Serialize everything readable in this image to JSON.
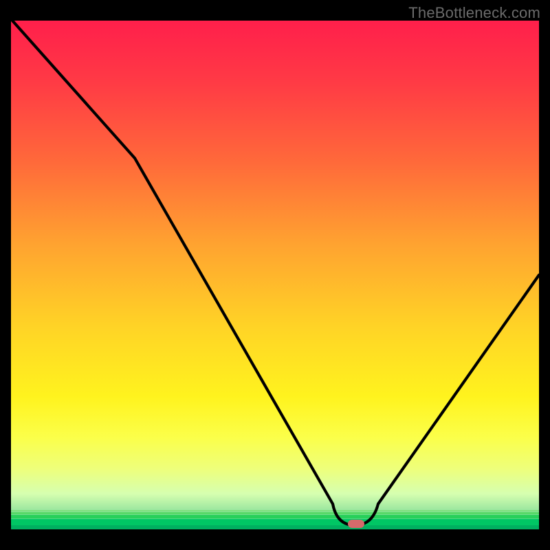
{
  "watermark": "TheBottleneck.com",
  "gradient_css": "background: linear-gradient(to bottom, #ff1f4b 0%, #ff3a45 12%, #ff6a3a 28%, #ffa330 44%, #ffd326 60%, #fff31e 74%, #fbff4a 82%, #eeff7a 88%, #d6ffb0 93%, #9fe8a0 96%, #00c764 100%);",
  "colors": {
    "worst": "#ff1f4b",
    "mid": "#ffd326",
    "best": "#00c764",
    "curve": "#000000",
    "marker": "#d66a6b",
    "frame": "#000000",
    "watermark": "#6b6b6b"
  },
  "chart_data": {
    "type": "line",
    "title": "",
    "xlabel": "",
    "ylabel": "",
    "xlim": [
      0,
      100
    ],
    "ylim": [
      0,
      100
    ],
    "grid": false,
    "legend": false,
    "background": "vertical red→yellow→green heatmap gradient (red = high bottleneck, green = low)",
    "series": [
      {
        "name": "bottleneck-curve",
        "x": [
          0,
          23,
          61,
          62,
          65,
          68,
          69,
          100
        ],
        "values": [
          100,
          73,
          5,
          0.8,
          0.8,
          0.8,
          5,
          50
        ]
      }
    ],
    "optimal_point": {
      "x": 65,
      "y": 0.8
    },
    "annotations": [
      {
        "text": "TheBottleneck.com",
        "role": "watermark",
        "position": "top-right"
      }
    ]
  }
}
